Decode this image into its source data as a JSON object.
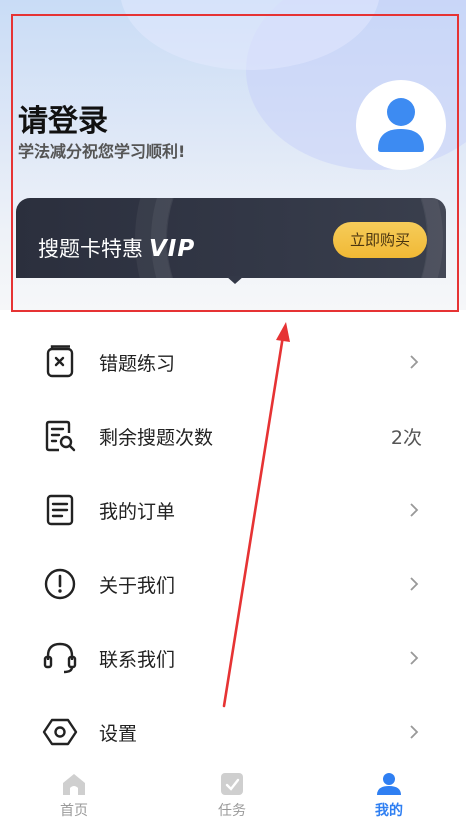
{
  "header": {
    "title": "请登录",
    "subtitle": "学法减分祝您学习顺利!"
  },
  "vip": {
    "text": "搜题卡特惠",
    "logo": "VIP",
    "buy_label": "立即购买"
  },
  "menu": {
    "items": [
      {
        "label": "错题练习",
        "icon": "wrong-notebook-icon"
      },
      {
        "label": "剩余搜题次数",
        "icon": "search-document-icon",
        "value": "2次"
      },
      {
        "label": "我的订单",
        "icon": "order-document-icon"
      },
      {
        "label": "关于我们",
        "icon": "info-exclamation-icon"
      },
      {
        "label": "联系我们",
        "icon": "headset-icon"
      },
      {
        "label": "设置",
        "icon": "settings-hexagon-icon"
      }
    ]
  },
  "tabbar": {
    "tabs": [
      {
        "label": "首页",
        "icon": "home-icon"
      },
      {
        "label": "任务",
        "icon": "task-icon"
      },
      {
        "label": "我的",
        "icon": "profile-icon",
        "active": true
      }
    ]
  },
  "colors": {
    "accent": "#2f7ff2",
    "highlight": "#e63334",
    "vip_button": "#f1b935"
  }
}
